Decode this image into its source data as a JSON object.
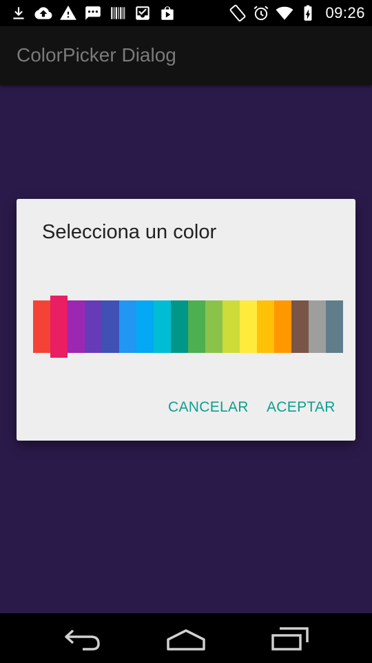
{
  "status_bar": {
    "time": "09:26",
    "left_icons": [
      "download-icon",
      "cloud-upload-icon",
      "warning-icon",
      "message-icon",
      "barcode-icon",
      "inbox-icon",
      "shopping-bag-icon"
    ],
    "right_icons": [
      "rotation-icon",
      "alarm-icon",
      "wifi-icon",
      "battery-charging-icon"
    ]
  },
  "action_bar": {
    "title": "ColorPicker Dialog"
  },
  "dialog": {
    "title": "Selecciona un color",
    "selected_index": 1,
    "colors": [
      "#f44336",
      "#e91e63",
      "#9c27b0",
      "#673ab7",
      "#3f51b5",
      "#2196f3",
      "#03a9f4",
      "#00bcd4",
      "#009688",
      "#4caf50",
      "#8bc34a",
      "#cddc39",
      "#ffeb3b",
      "#ffc107",
      "#ff9800",
      "#795548",
      "#9e9e9e",
      "#607d8b"
    ],
    "cancel_label": "CANCELAR",
    "accept_label": "ACEPTAR"
  },
  "nav_bar": {
    "buttons": [
      "back-icon",
      "home-icon",
      "recents-icon"
    ]
  },
  "theme": {
    "accent": "#0d9e8e",
    "scrim_background": "#2a1a4a",
    "dialog_background": "#eeeeee"
  }
}
